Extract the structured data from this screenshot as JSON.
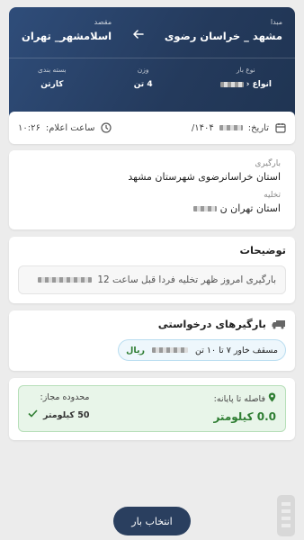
{
  "header": {
    "origin_label": "مبدا",
    "origin_value": "مشهد _ خراسان رضوی",
    "destination_label": "مقصد",
    "destination_value": "اسلامشهر_ تهران",
    "arrow_icon": "arrow-left-icon",
    "meta": {
      "cargo_type_label": "نوع بار",
      "cargo_type_value": "انواع",
      "weight_label": "وزن",
      "weight_value": "4 تن",
      "packaging_label": "بسته بندی",
      "packaging_value": "کارتن"
    }
  },
  "dates": {
    "date_label": "تاریخ:",
    "date_value": "۱۴۰۴/",
    "announce_label": "ساعت اعلام:",
    "announce_value": "۱۰:۲۶",
    "calendar_icon": "calendar-icon",
    "clock_icon": "clock-icon"
  },
  "loading": {
    "load_label": "بارگیری",
    "load_value": "استان خراسانرضوی شهرستان مشهد",
    "unload_label": "تخلیه",
    "unload_value": "استان تهران ن"
  },
  "description": {
    "title": "توضیحات",
    "text": "بارگیری امروز ظهر تخلیه فردا قبل ساعت 12"
  },
  "trucks": {
    "title": "بارگیرهای درخواستی",
    "truck_icon": "truck-icon",
    "chip_text": "مسقف خاور ۷ تا ۱۰ تن",
    "chip_currency": "ریال"
  },
  "distance": {
    "to_end_label": "فاصله تا پایانه:",
    "to_end_value": "0.0 کیلومتر",
    "allowed_label": "محدوده مجاز:",
    "allowed_value": "50 کیلومتر",
    "colors": {
      "green": "#2e7d32"
    }
  },
  "action": {
    "select_label": "انتخاب بار"
  },
  "colors": {
    "header_bg": "#2a4066",
    "button_bg": "#2a3f5f"
  }
}
